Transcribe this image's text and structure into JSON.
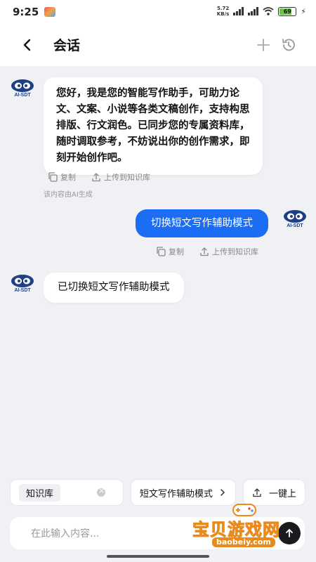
{
  "status_bar": {
    "time": "9:25",
    "net_speed_value": "5.72",
    "net_speed_unit": "KB/s",
    "battery": "69"
  },
  "header": {
    "title": "会话"
  },
  "messages": {
    "assistant_intro": "您好，我是您的智能写作助手，可助力论文、文案、小说等各类文稿创作，支持构思排版、行文润色。已同步您的专属资料库，随时调取参考，不妨说出你的创作需求，即刻开始创作吧。",
    "user_msg": "切换短文写作辅助模式",
    "assistant_reply": "已切换短文写作辅助模式",
    "avatar_text": "AI-SDT"
  },
  "actions": {
    "copy": "复制",
    "upload": "上传到知识库"
  },
  "ai_note": "该内容由AI生成",
  "chips": {
    "knowledge": "知识库",
    "mode": "短文写作辅助模式",
    "one_click": "一键上"
  },
  "input": {
    "placeholder": "在此输入内容..."
  },
  "watermark": {
    "text": "宝贝游戏网",
    "url": "baobeiy.com"
  },
  "colors": {
    "accent": "#1b6ef3",
    "background": "#f0f1f5"
  }
}
